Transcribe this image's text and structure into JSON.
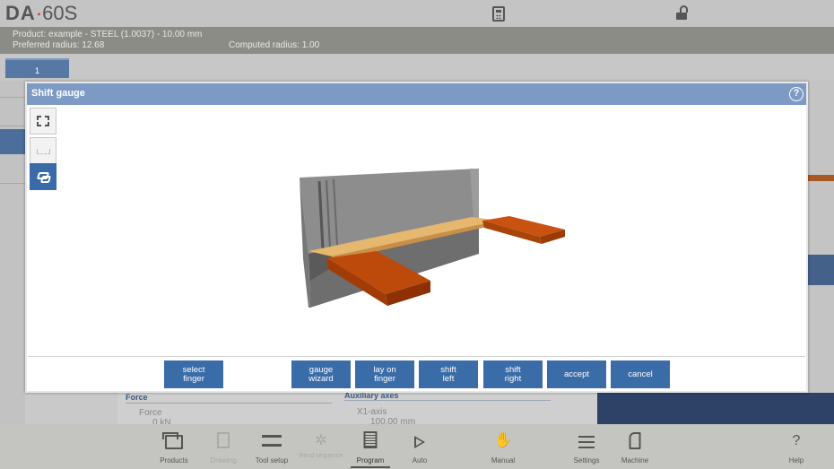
{
  "app": {
    "logo_brand": "DA",
    "logo_dot": "·",
    "logo_model": "60S",
    "icons": {
      "calculator": "calculator-icon",
      "lock": "unlock-icon"
    }
  },
  "info": {
    "product": "Product: example - STEEL (1.0037) - 10.00 mm",
    "preferred_radius": "Preferred radius: 12.68",
    "computed_radius": "Computed radius: 1.00"
  },
  "tabs": [
    {
      "label": "1"
    }
  ],
  "background_panel": {
    "force_header": "Force",
    "force_label": "Force",
    "force_value": "0 kN",
    "aux_header": "Auxiliary axes",
    "x1_label": "X1-axis",
    "x1_value": "100.00 mm"
  },
  "modal": {
    "title": "Shift gauge",
    "help_symbol": "?",
    "tools": [
      "fit-view-icon",
      "side-view-icon",
      "gauge-view-icon"
    ],
    "buttons": {
      "select_finger": "select\nfinger",
      "gauge_wizard": "gauge\nwizard",
      "lay_on_finger": "lay on\nfinger",
      "shift_left": "shift\nleft",
      "shift_right": "shift\nright",
      "accept": "accept",
      "cancel": "cancel"
    }
  },
  "nav": [
    {
      "label": "Products",
      "state": "normal"
    },
    {
      "label": "Drawing",
      "state": "disabled"
    },
    {
      "label": "Tool setup",
      "state": "normal"
    },
    {
      "label": "Bend sequence",
      "state": "disabled"
    },
    {
      "label": "Program",
      "state": "active"
    },
    {
      "label": "Auto",
      "state": "normal"
    },
    {
      "label": "Manual",
      "state": "normal"
    },
    {
      "label": "Settings",
      "state": "normal"
    },
    {
      "label": "Machine",
      "state": "normal"
    },
    {
      "label": "Help",
      "state": "normal"
    }
  ],
  "colors": {
    "accent_blue": "#3a6ca8",
    "header_blue": "#7c9ac4",
    "gauge_orange": "#b84a0c",
    "sheet_tan": "#e6b76e",
    "tool_gray": "#8a8a8a"
  }
}
